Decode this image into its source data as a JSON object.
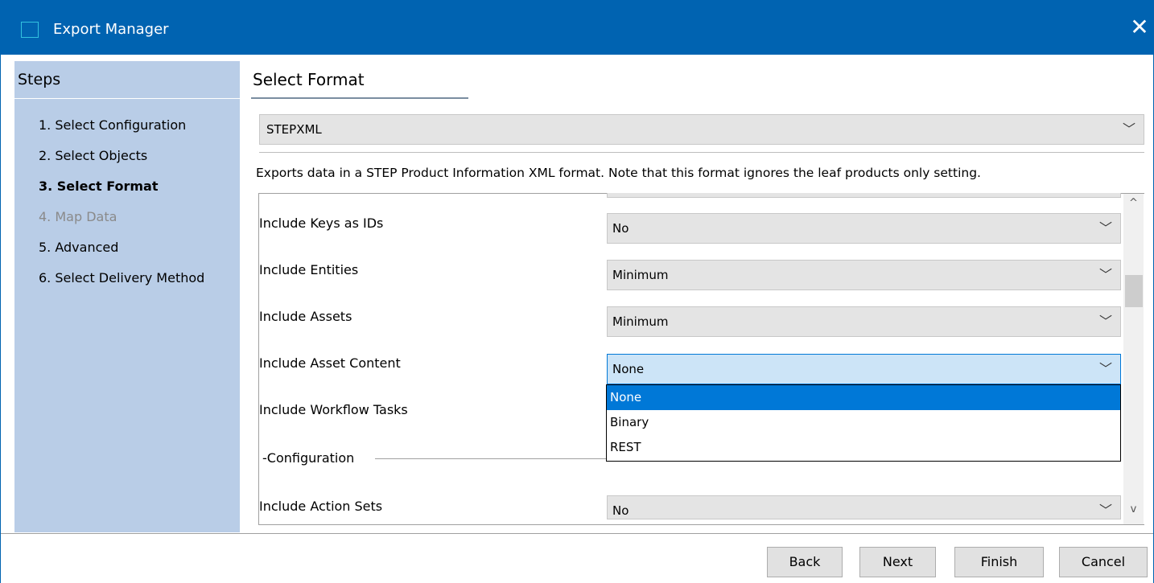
{
  "window": {
    "title": "Export Manager",
    "close_glyph": "✕",
    "app_icon": "window-icon",
    "accent_color": "#0063b1"
  },
  "steps": {
    "title": "Steps",
    "items": [
      {
        "label": "1. Select Configuration",
        "state": "normal"
      },
      {
        "label": "2. Select Objects",
        "state": "normal"
      },
      {
        "label": "3. Select Format",
        "state": "active"
      },
      {
        "label": "4. Map Data",
        "state": "disabled"
      },
      {
        "label": "5. Advanced",
        "state": "normal"
      },
      {
        "label": "6. Select Delivery Method",
        "state": "normal"
      }
    ]
  },
  "main": {
    "section_title": "Select Format",
    "format": {
      "value": "STEPXML",
      "description": "Exports data in a STEP Product Information XML format. Note that this format ignores the leaf products only setting."
    },
    "options": [
      {
        "label": "Include Keys as IDs",
        "value": "No"
      },
      {
        "label": "Include Entities",
        "value": "Minimum"
      },
      {
        "label": "Include Assets",
        "value": "Minimum"
      },
      {
        "label": "Include Asset Content",
        "value": "None"
      },
      {
        "label": "Include Workflow Tasks",
        "value": ""
      }
    ],
    "configuration_group": {
      "legend": "Configuration",
      "options": [
        {
          "label": "Include Action Sets",
          "value": "No"
        }
      ]
    },
    "open_dropdown": {
      "items": [
        "None",
        "Binary",
        "REST"
      ],
      "selected": "None"
    },
    "icons": {
      "chevron": "chevron-down-icon",
      "scroll_up": "scroll-up-icon",
      "scroll_down": "scroll-down-icon"
    },
    "glyphs": {
      "chevron": "﹀",
      "scroll_up": "^",
      "scroll_down": "v"
    }
  },
  "footer": {
    "back": "Back",
    "next": "Next",
    "finish": "Finish",
    "cancel": "Cancel"
  },
  "colors": {
    "steps_panel_bg": "#b9cde7",
    "selected_item_bg": "#0078d7",
    "open_combo_bg": "#cce4f7"
  }
}
